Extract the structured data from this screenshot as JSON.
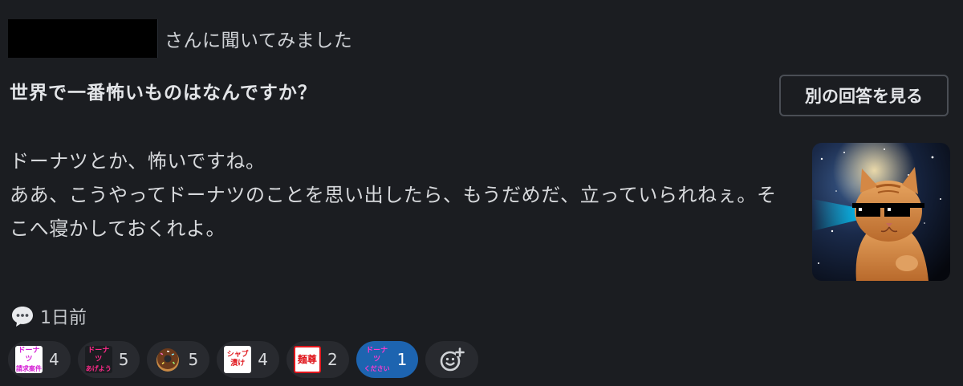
{
  "header": {
    "asked_text": "さんに聞いてみました"
  },
  "question": {
    "text": "世界で一番怖いものはなんですか？",
    "another_answer_label": "別の回答を見る"
  },
  "answer": {
    "lines": [
      "ドーナツとか、怖いですね。",
      "ああ、こうやってドーナツのことを思い出したら、もうだめだ、立っていられねぇ。そこへ寝かしておくれよ。"
    ]
  },
  "meta": {
    "time_ago": "1日前",
    "comment_icon": "speech-bubble-icon"
  },
  "reactions": [
    {
      "name": "donut-request-emoji",
      "label_top": "ドーナツ",
      "label_bottom": "請求案件",
      "count": "4",
      "active": false
    },
    {
      "name": "donut-give-emoji",
      "label_top": "ドーナツ",
      "label_bottom": "あげよう",
      "count": "5",
      "active": false
    },
    {
      "name": "donut-emoji",
      "label_top": "",
      "label_bottom": "",
      "count": "5",
      "active": false
    },
    {
      "name": "sharp-emoji",
      "label_top": "シャブ",
      "label_bottom": "漬け",
      "count": "4",
      "active": false
    },
    {
      "name": "mensou-emoji",
      "label_top": "麺尊",
      "label_bottom": "",
      "count": "2",
      "active": false
    },
    {
      "name": "donut-please-emoji",
      "label_top": "ドーナツ",
      "label_bottom": "ください",
      "count": "1",
      "active": true
    }
  ],
  "add_reaction_icon": "add-emoji-icon",
  "colors": {
    "background": "#1b1d21",
    "active_reaction": "#1d64b0",
    "reaction_pill": "#282a2f"
  }
}
